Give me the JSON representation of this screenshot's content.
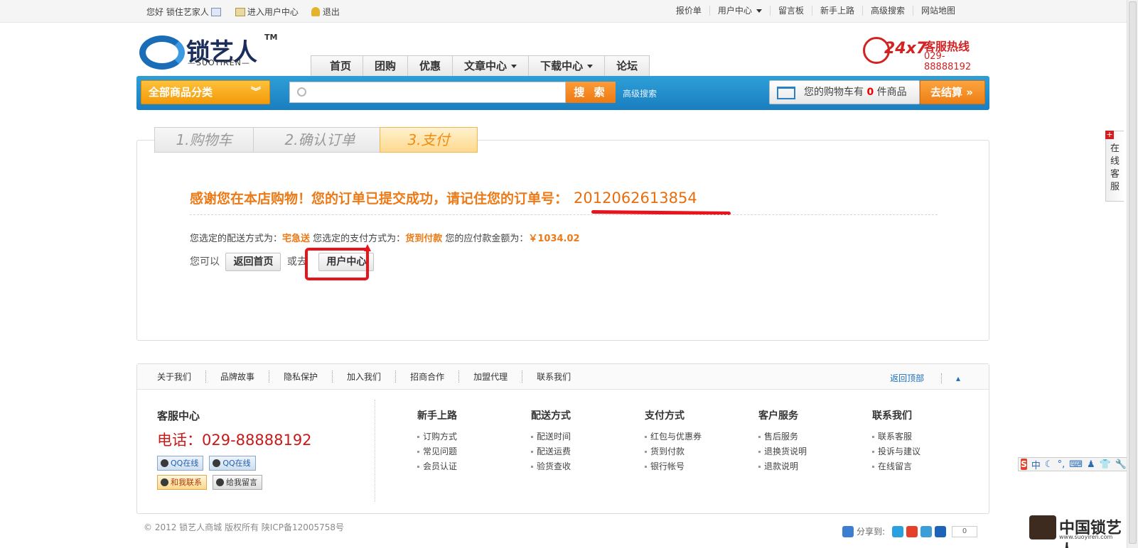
{
  "topbar": {
    "greeting": "您好 锁住艺家人",
    "user_center_link": "进入用户中心",
    "logout": "退出",
    "right_links": [
      "报价单",
      "用户中心",
      "留言板",
      "新手上路",
      "高级搜索",
      "网站地图"
    ]
  },
  "logo": {
    "name": "锁艺人",
    "tm": "TM",
    "en": "—SUOYIREN—"
  },
  "hotline": {
    "badge": "24x7",
    "title": "客服热线",
    "number": "029-88888192"
  },
  "nav": [
    {
      "label": "首页",
      "dropdown": false
    },
    {
      "label": "团购",
      "dropdown": false
    },
    {
      "label": "优惠",
      "dropdown": false
    },
    {
      "label": "文章中心",
      "dropdown": true
    },
    {
      "label": "下载中心",
      "dropdown": true
    },
    {
      "label": "论坛",
      "dropdown": false
    }
  ],
  "search": {
    "category_label": "全部商品分类",
    "placeholder": "",
    "button": "搜 索",
    "advanced": "高级搜索"
  },
  "cart": {
    "prefix": "您的购物车有",
    "count": "0",
    "suffix": "件商品",
    "checkout": "去结算"
  },
  "steps": [
    "1.购物车",
    "2.确认订单",
    "3.支付"
  ],
  "active_step": 3,
  "order": {
    "message": "感谢您在本店购物！您的订单已提交成功，请记住您的订单号：",
    "number": "2012062613854",
    "shipping_label": "您选定的配送方式为：",
    "shipping_value": "宅急送",
    "payment_label": "您选定的支付方式为：",
    "payment_value": "货到付款",
    "amount_label": "您的应付款金额为：",
    "amount_value": "￥1034.02"
  },
  "actions": {
    "prefix": "您可以",
    "home_button": "返回首页",
    "or": "或去",
    "user_center_button": "用户中心"
  },
  "footer": {
    "links": [
      "关于我们",
      "品牌故事",
      "隐私保护",
      "加入我们",
      "招商合作",
      "加盟代理",
      "联系我们"
    ],
    "back_to_top": "返回顶部",
    "service_title": "客服中心",
    "service_tel": "电话：029-88888192",
    "qq1": "QQ在线",
    "qq2": "QQ在线",
    "contact_me": "和我联系",
    "leave_message": "给我留言",
    "columns": [
      {
        "title": "新手上路",
        "items": [
          "订购方式",
          "常见问题",
          "会员认证"
        ]
      },
      {
        "title": "配送方式",
        "items": [
          "配送时间",
          "配送运费",
          "验货查收"
        ]
      },
      {
        "title": "支付方式",
        "items": [
          "红包与优惠券",
          "货到付款",
          "银行帐号"
        ]
      },
      {
        "title": "客户服务",
        "items": [
          "售后服务",
          "退换货说明",
          "退款说明"
        ]
      },
      {
        "title": "联系我们",
        "items": [
          "联系客服",
          "投诉与建议",
          "在线留言"
        ]
      }
    ],
    "copyright": "© 2012 锁艺人商城 版权所有 陕ICP备12005758号",
    "share_label": "分享到:",
    "share_count": "0"
  },
  "side_tab": "在线客服",
  "ime": {
    "logo": "S",
    "mode": "中"
  },
  "watermark": {
    "text": "中国锁艺人",
    "url": "www.suoyiren.com"
  },
  "colors": {
    "accent_orange": "#ec7a17",
    "bar_blue": "#1a7ec0",
    "annotation_red": "#e8141c"
  }
}
